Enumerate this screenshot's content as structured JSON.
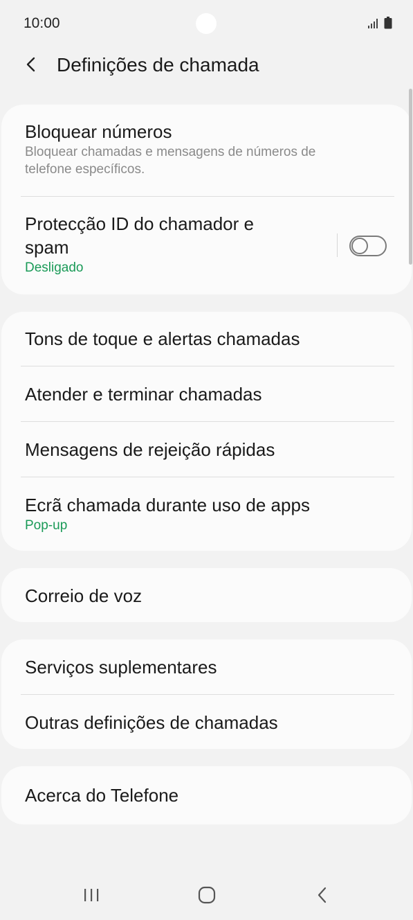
{
  "status_bar": {
    "time": "10:00"
  },
  "header": {
    "title": "Definições de chamada"
  },
  "card1": {
    "block_numbers": {
      "title": "Bloquear números",
      "subtitle": "Bloquear chamadas e mensagens de números de telefone específicos."
    },
    "caller_id": {
      "title": "Protecção ID do chamador e spam",
      "status": "Desligado",
      "toggle_on": false
    }
  },
  "card2": {
    "ringtones": {
      "title": "Tons de toque e alertas chamadas"
    },
    "answer_end": {
      "title": "Atender e terminar chamadas"
    },
    "quick_decline": {
      "title": "Mensagens de rejeição rápidas"
    },
    "call_display": {
      "title": "Ecrã chamada durante uso de apps",
      "status": "Pop-up"
    }
  },
  "card3": {
    "voicemail": {
      "title": "Correio de voz"
    }
  },
  "card4": {
    "supplementary": {
      "title": "Serviços suplementares"
    },
    "other_settings": {
      "title": "Outras definições de chamadas"
    }
  },
  "card5": {
    "about_phone": {
      "title": "Acerca do Telefone"
    }
  },
  "icons": {
    "signal": "signal-icon",
    "battery": "battery-icon",
    "back": "back-arrow-icon",
    "recent_apps": "recent-apps-icon",
    "home": "home-icon",
    "nav_back": "nav-back-icon"
  },
  "colors": {
    "accent_status": "#1a9a57",
    "background": "#f2f2f2",
    "card": "#fbfbfb"
  }
}
